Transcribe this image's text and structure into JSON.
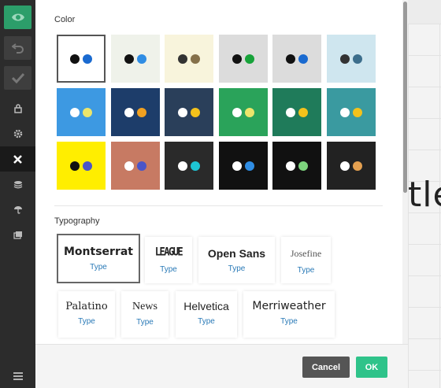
{
  "canvas": {
    "visible_text": "tle"
  },
  "toolbar": {
    "buttons": [
      {
        "icon": "eye-icon",
        "label": "preview"
      },
      {
        "icon": "undo-icon",
        "label": "undo"
      },
      {
        "icon": "check-icon",
        "label": "save"
      }
    ],
    "items": [
      {
        "icon": "lock-icon"
      },
      {
        "icon": "gear-icon"
      },
      {
        "icon": "close-icon",
        "active": true
      },
      {
        "icon": "layers-icon"
      },
      {
        "icon": "umbrella-icon"
      },
      {
        "icon": "pages-icon"
      }
    ],
    "menu_icon": "hamburger-icon"
  },
  "panel": {
    "color_title": "Color",
    "typography_title": "Typography",
    "colors": [
      {
        "bg": "#ffffff",
        "dot1": "#111111",
        "dot2": "#1a6ad0",
        "selected": true
      },
      {
        "bg": "#eff2ea",
        "dot1": "#111111",
        "dot2": "#2f8de4"
      },
      {
        "bg": "#f8f4dc",
        "dot1": "#333333",
        "dot2": "#85704a"
      },
      {
        "bg": "#dcdcdc",
        "dot1": "#111111",
        "dot2": "#17a33a"
      },
      {
        "bg": "#dcdcdc",
        "dot1": "#111111",
        "dot2": "#1a6ad0"
      },
      {
        "bg": "#cfe6ef",
        "dot1": "#333333",
        "dot2": "#3c6e8c"
      },
      {
        "bg": "#3d99e2",
        "dot1": "#ffffff",
        "dot2": "#ece56b"
      },
      {
        "bg": "#1d3d6a",
        "dot1": "#ffffff",
        "dot2": "#f0a020"
      },
      {
        "bg": "#2a3f5a",
        "dot1": "#ffffff",
        "dot2": "#f4c21b"
      },
      {
        "bg": "#2aa35a",
        "dot1": "#ffffff",
        "dot2": "#ece56b"
      },
      {
        "bg": "#1f7b5a",
        "dot1": "#ffffff",
        "dot2": "#f4c21b"
      },
      {
        "bg": "#3a9aa0",
        "dot1": "#ffffff",
        "dot2": "#f4c21b"
      },
      {
        "bg": "#ffee00",
        "dot1": "#111111",
        "dot2": "#4a55c8"
      },
      {
        "bg": "#c77a63",
        "dot1": "#ffffff",
        "dot2": "#4a55c8"
      },
      {
        "bg": "#2a2a2a",
        "dot1": "#ffffff",
        "dot2": "#1ec4d4"
      },
      {
        "bg": "#111111",
        "dot1": "#ffffff",
        "dot2": "#2f8de4"
      },
      {
        "bg": "#111111",
        "dot1": "#ffffff",
        "dot2": "#7dd37d"
      },
      {
        "bg": "#222222",
        "dot1": "#ffffff",
        "dot2": "#e4a050"
      }
    ],
    "fonts": [
      {
        "name": "Montserrat",
        "type": "Type",
        "selected": true
      },
      {
        "name": "LEAGUE",
        "type": "Type"
      },
      {
        "name": "Open Sans",
        "type": "Type"
      },
      {
        "name": "Josefine",
        "type": "Type"
      },
      {
        "name": "Palatino",
        "type": "Type"
      },
      {
        "name": "News",
        "type": "Type"
      },
      {
        "name": "Helvetica",
        "type": "Type"
      },
      {
        "name": "Merriweather",
        "type": "Type"
      }
    ]
  },
  "footer": {
    "cancel_label": "Cancel",
    "ok_label": "OK"
  }
}
